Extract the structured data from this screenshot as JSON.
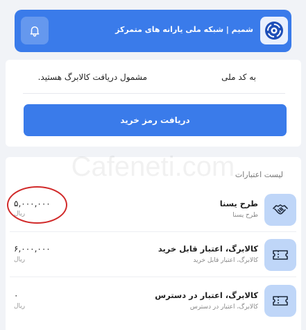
{
  "header": {
    "title": "شمیم | شبکه ملی یارانه های متمرکز",
    "logo_icon": "swirl-logo-icon",
    "notification_icon": "bell-icon"
  },
  "eligibility": {
    "label": "به کد ملی",
    "message": "مشمول دریافت کالابرگ هستید."
  },
  "cta": {
    "label": "دریافت رمز خرید"
  },
  "watermark": "Cafeneti.com",
  "credits": {
    "title": "لیست اعتبارات",
    "items": [
      {
        "title": "طرح یسنا",
        "subtitle": "طرح یسنا",
        "amount": "۵,۰۰۰,۰۰۰",
        "unit": "ریال",
        "icon": "handshake-icon"
      },
      {
        "title": "کالابرگ، اعتبار قابل خرید",
        "subtitle": "کالابرگ، اعتبار قابل خرید",
        "amount": "۶,۰۰۰,۰۰۰",
        "unit": "ریال",
        "icon": "ticket-icon"
      },
      {
        "title": "کالابرگ، اعتبار در دسترس",
        "subtitle": "کالابرگ، اعتبار در دسترس",
        "amount": "۰",
        "unit": "ریال",
        "icon": "ticket-icon"
      }
    ]
  },
  "colors": {
    "primary": "#3a7bea",
    "icon_bg": "#bfd6f8",
    "highlight": "#d12a2a"
  }
}
